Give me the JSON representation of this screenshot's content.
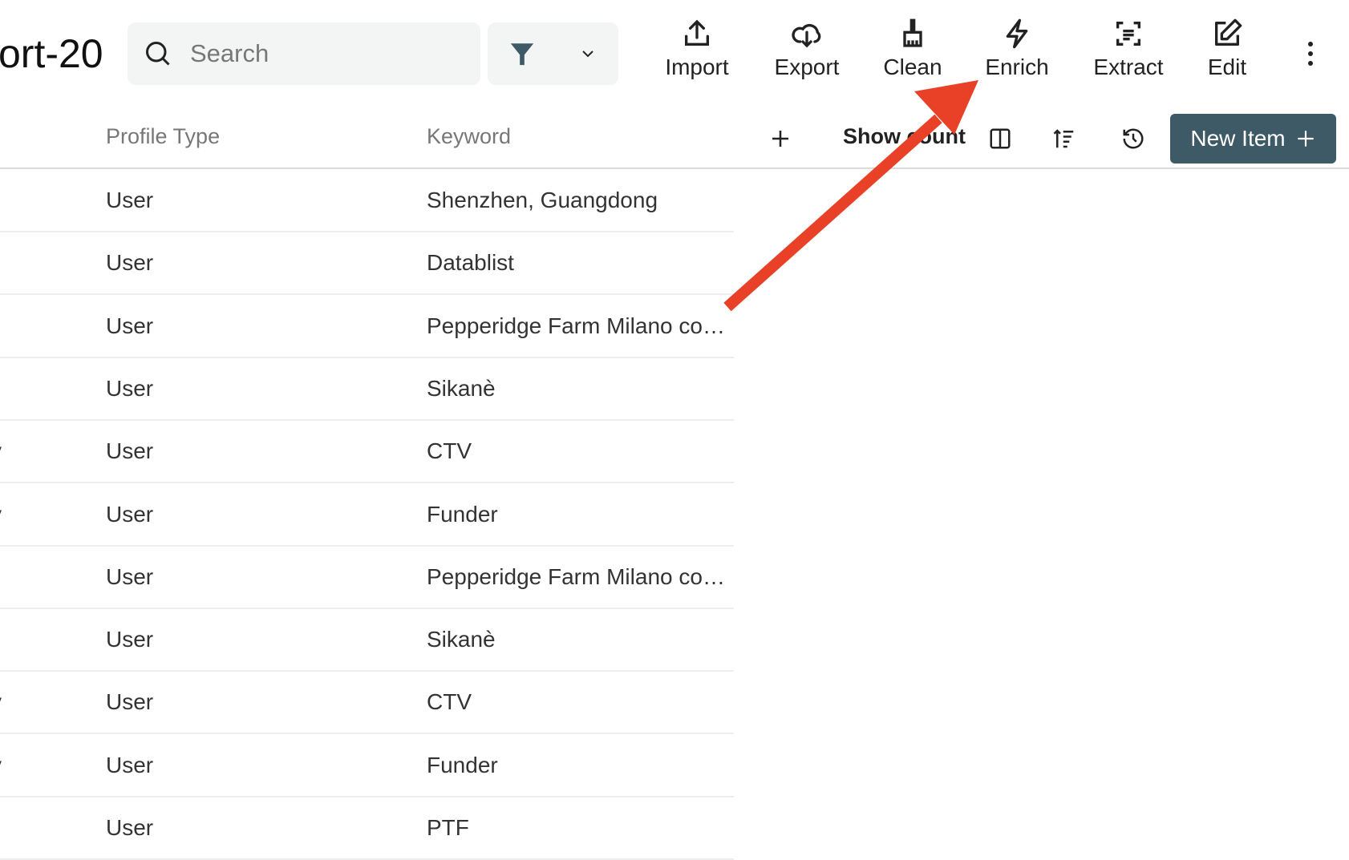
{
  "header": {
    "title": "ort-20",
    "search_placeholder": "Search"
  },
  "toolbar": [
    {
      "label": "Import",
      "icon": "upload-icon"
    },
    {
      "label": "Export",
      "icon": "cloud-download-icon"
    },
    {
      "label": "Clean",
      "icon": "broom-icon"
    },
    {
      "label": "Enrich",
      "icon": "lightning-icon"
    },
    {
      "label": "Extract",
      "icon": "scan-text-icon"
    },
    {
      "label": "Edit",
      "icon": "edit-icon"
    }
  ],
  "table": {
    "columns": [
      "Profile Type",
      "Keyword"
    ],
    "show_count": "Show count",
    "new_item": "New Item",
    "rows": [
      {
        "lead": "",
        "type": "User",
        "keyword": "Shenzhen, Guangdong"
      },
      {
        "lead": "",
        "type": "User",
        "keyword": "Datablist"
      },
      {
        "lead": "",
        "type": "User",
        "keyword": "Pepperidge Farm Milano co…"
      },
      {
        "lead": "",
        "type": "User",
        "keyword": "Sikanè"
      },
      {
        "lead": "y",
        "type": "User",
        "keyword": "CTV"
      },
      {
        "lead": "y",
        "type": "User",
        "keyword": "Funder"
      },
      {
        "lead": "",
        "type": "User",
        "keyword": "Pepperidge Farm Milano co…"
      },
      {
        "lead": "",
        "type": "User",
        "keyword": "Sikanè"
      },
      {
        "lead": "y",
        "type": "User",
        "keyword": "CTV"
      },
      {
        "lead": "y",
        "type": "User",
        "keyword": "Funder"
      },
      {
        "lead": "",
        "type": "User",
        "keyword": "PTF"
      }
    ]
  },
  "colors": {
    "accent": "#3d5a66",
    "annotation_arrow": "#e84127"
  }
}
